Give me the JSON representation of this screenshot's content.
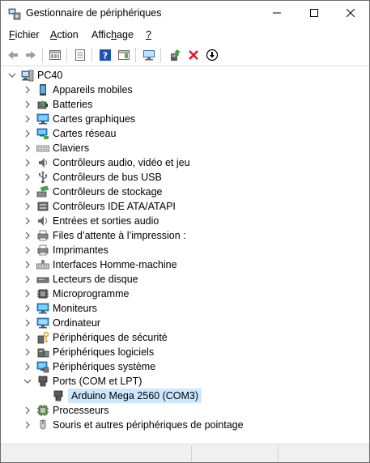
{
  "window": {
    "title": "Gestionnaire de périphériques",
    "icon": "device-manager-icon"
  },
  "menu": [
    {
      "label": "Fichier"
    },
    {
      "label": "Action"
    },
    {
      "label": "Affichage"
    },
    {
      "label": "?"
    }
  ],
  "toolbar": {
    "buttons": [
      "back-arrow",
      "forward-arrow",
      "show-hidden",
      "properties",
      "help",
      "action-pane",
      "scan-hardware",
      "update-driver",
      "uninstall-device",
      "disable-device"
    ]
  },
  "tree": {
    "root": "PC40",
    "categories": [
      {
        "label": "Appareils mobiles",
        "icon": "mobile-device-icon",
        "expanded": false
      },
      {
        "label": "Batteries",
        "icon": "battery-icon",
        "expanded": false
      },
      {
        "label": "Cartes graphiques",
        "icon": "display-adapter-icon",
        "expanded": false
      },
      {
        "label": "Cartes réseau",
        "icon": "network-adapter-icon",
        "expanded": false
      },
      {
        "label": "Claviers",
        "icon": "keyboard-icon",
        "expanded": false
      },
      {
        "label": "Contrôleurs audio, vidéo et jeu",
        "icon": "speaker-icon",
        "expanded": false
      },
      {
        "label": "Contrôleurs de bus USB",
        "icon": "usb-icon",
        "expanded": false
      },
      {
        "label": "Contrôleurs de stockage",
        "icon": "storage-controller-icon",
        "expanded": false
      },
      {
        "label": "Contrôleurs IDE ATA/ATAPI",
        "icon": "ide-icon",
        "expanded": false
      },
      {
        "label": "Entrées et sorties audio",
        "icon": "audio-io-icon",
        "expanded": false
      },
      {
        "label": "Files d’attente à l’impression :",
        "icon": "print-queue-icon",
        "expanded": false
      },
      {
        "label": "Imprimantes",
        "icon": "printer-icon",
        "expanded": false
      },
      {
        "label": "Interfaces Homme-machine",
        "icon": "hid-icon",
        "expanded": false
      },
      {
        "label": "Lecteurs de disque",
        "icon": "disk-drive-icon",
        "expanded": false
      },
      {
        "label": "Microprogramme",
        "icon": "firmware-icon",
        "expanded": false
      },
      {
        "label": "Moniteurs",
        "icon": "monitor-icon",
        "expanded": false
      },
      {
        "label": "Ordinateur",
        "icon": "computer-icon",
        "expanded": false
      },
      {
        "label": "Périphériques de sécurité",
        "icon": "security-device-icon",
        "expanded": false
      },
      {
        "label": "Périphériques logiciels",
        "icon": "software-device-icon",
        "expanded": false
      },
      {
        "label": "Périphériques système",
        "icon": "system-device-icon",
        "expanded": false
      },
      {
        "label": "Ports (COM et LPT)",
        "icon": "port-icon",
        "expanded": true,
        "children": [
          {
            "label": "Arduino Mega 2560 (COM3)",
            "icon": "port-icon",
            "selected": true
          }
        ]
      },
      {
        "label": "Processeurs",
        "icon": "processor-icon",
        "expanded": false
      },
      {
        "label": "Souris et autres périphériques de pointage",
        "icon": "mouse-icon",
        "expanded": false
      }
    ]
  },
  "colors": {
    "selection": "#cce8ff",
    "error_red": "#e81123",
    "help_blue": "#1c50b4"
  }
}
